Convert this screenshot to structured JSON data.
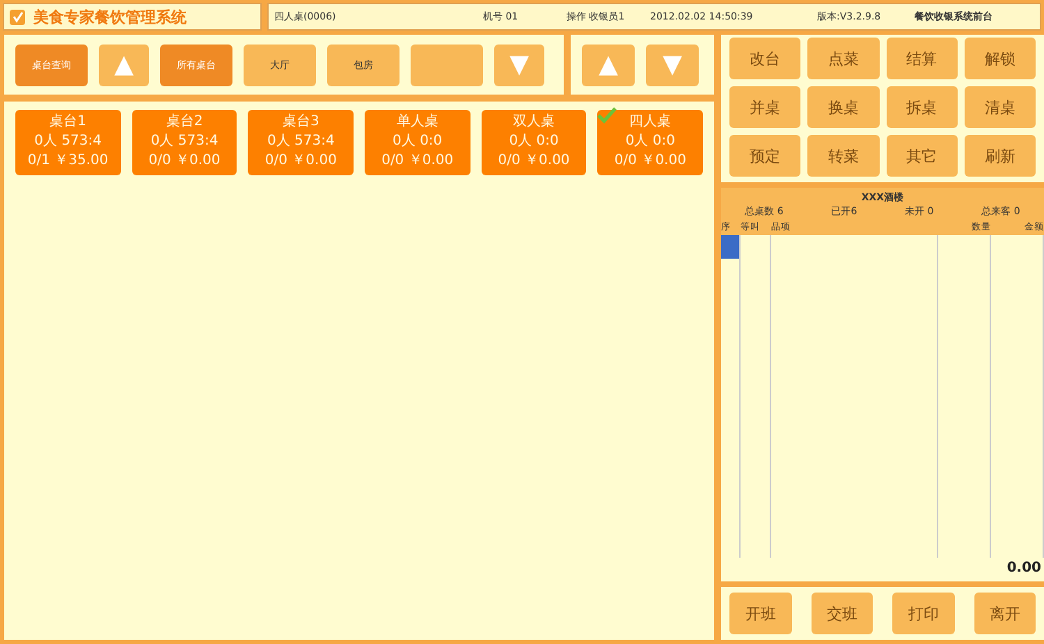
{
  "header": {
    "app_title": "美食专家餐饮管理系统",
    "table": "四人桌(0006)",
    "machine": "机号 01",
    "operator": "操作 收银员1",
    "datetime": "2012.02.02 14:50:39",
    "version": "版本:V3.2.9.8",
    "terminal": "餐饮收银系统前台"
  },
  "area_bar": [
    {
      "kind": "button",
      "label": "桌台查询",
      "selected": true
    },
    {
      "kind": "arrow",
      "label": "▲"
    },
    {
      "kind": "button",
      "label": "所有桌台",
      "selected": true
    },
    {
      "kind": "button",
      "label": "大厅",
      "selected": false
    },
    {
      "kind": "button",
      "label": "包房",
      "selected": false
    },
    {
      "kind": "button",
      "selected": false
    },
    {
      "kind": "arrow",
      "label": "▼"
    }
  ],
  "page_arrows": [
    "▲",
    "▼"
  ],
  "tables": [
    {
      "name": "桌台1",
      "line_2": "0人 573:4",
      "line_3": "0/1 ￥35.00",
      "checked": false
    },
    {
      "name": "桌台2",
      "line_2": "0人 573:4",
      "line_3": "0/0 ￥0.00",
      "checked": false
    },
    {
      "name": "桌台3",
      "line_2": "0人 573:4",
      "line_3": "0/0 ￥0.00",
      "checked": false
    },
    {
      "name": "单人桌",
      "line_2": "0人 0:0",
      "line_3": "0/0 ￥0.00",
      "checked": false
    },
    {
      "name": "双人桌",
      "line_2": "0人 0:0",
      "line_3": "0/0 ￥0.00",
      "checked": false
    },
    {
      "name": "四人桌",
      "line_2": "0人 0:0",
      "line_3": "0/0 ￥0.00",
      "checked": true
    }
  ],
  "actions": [
    "改台",
    "点菜",
    "结算",
    "解锁",
    "并桌",
    "换桌",
    "拆桌",
    "清桌",
    "预定",
    "转菜",
    "其它",
    "刷新"
  ],
  "summary": {
    "restaurant": "XXX酒楼",
    "stats": [
      "总桌数 6",
      "已开6",
      "未开 0",
      "总来客 0"
    ]
  },
  "order": {
    "columns": [
      "序",
      "等叫",
      "品项",
      "数量",
      "金额"
    ],
    "rows": [
      {
        "selected": true
      }
    ],
    "total": "0.00"
  },
  "footer_buttons": [
    "开班",
    "交班",
    "打印",
    "离开"
  ]
}
